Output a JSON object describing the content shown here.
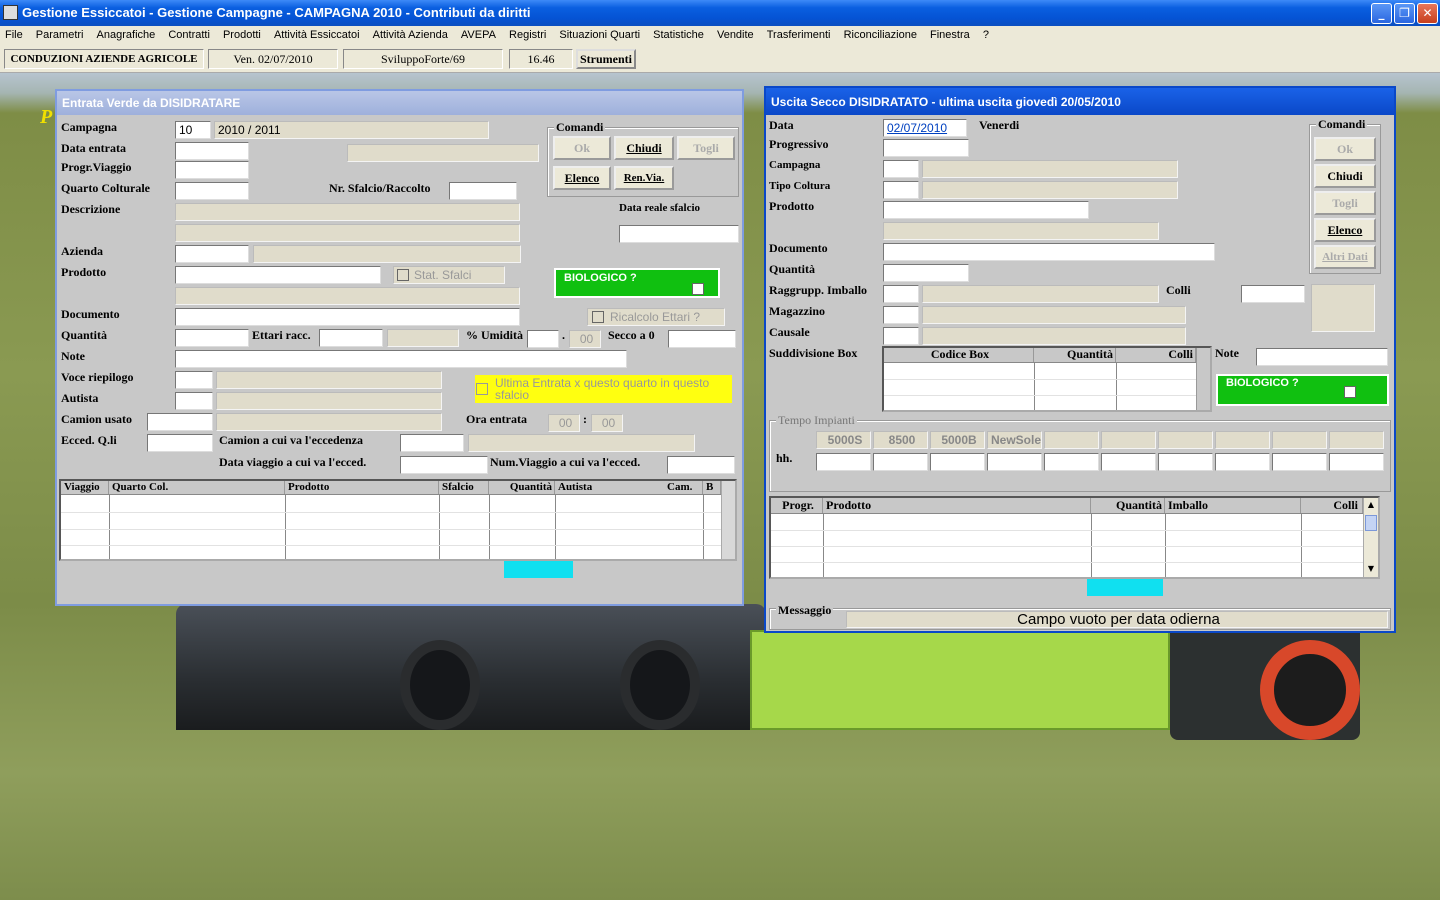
{
  "window": {
    "title": "Gestione Essiccatoi - Gestione Campagne  -  CAMPAGNA 2010 - Contributi da diritti"
  },
  "menu": [
    "File",
    "Parametri",
    "Anagrafiche",
    "Contratti",
    "Prodotti",
    "Attività Essiccatoi",
    "Attività Azienda",
    "AVEPA",
    "Registri",
    "Situazioni Quarti",
    "Statistiche",
    "Vendite",
    "Trasferimenti",
    "Riconciliazione",
    "Finestra",
    "?"
  ],
  "status": {
    "company": "CONDUZIONI AZIENDE AGRICOLE",
    "date": "Ven. 02/07/2010",
    "user": "SviluppoForte/69",
    "time": "16.46",
    "tools_label": "Strumenti"
  },
  "bg_glyph": "P",
  "entrata": {
    "title": "Entrata Verde da DISIDRATARE",
    "labels": {
      "campagna": "Campagna",
      "data_entrata": "Data entrata",
      "progr_viaggio": "Progr.Viaggio",
      "quarto": "Quarto Colturale",
      "nr_sfalcio": "Nr. Sfalcio/Raccolto",
      "descrizione": "Descrizione",
      "data_reale": "Data reale sfalcio",
      "azienda": "Azienda",
      "prodotto": "Prodotto",
      "stat_sfalci": "Stat. Sfalci",
      "biologico": "BIOLOGICO ?",
      "documento": "Documento",
      "ricalcolo": "Ricalcolo Ettari ?",
      "quantita": "Quantità",
      "ettari": "Ettari racc.",
      "umidita": "% Umidità",
      "secco": "Secco a 0",
      "note": "Note",
      "voce": "Voce riepilogo",
      "ultima": "Ultima Entrata x questo quarto in questo sfalcio",
      "autista": "Autista",
      "camion": "Camion usato",
      "ora": "Ora entrata",
      "ecced": "Ecced. Q.li",
      "camion_ecc": "Camion a cui va l'eccedenza",
      "data_viaggio": "Data viaggio a cui va l'ecced.",
      "num_viaggio": "Num.Viaggio a cui va l'ecced."
    },
    "values": {
      "campagna_code": "10",
      "campagna_year": "2010 / 2011",
      "umid_dec": "00",
      "ora_h": "00",
      "ora_m": "00",
      "sep": ":",
      "dot": "."
    },
    "commands": {
      "title": "Comandi",
      "ok": "Ok",
      "chiudi": "Chiudi",
      "togli": "Togli",
      "elenco": "Elenco",
      "renvia": "Ren.Via."
    },
    "grid_cols": [
      "Viaggio",
      "Quarto Col.",
      "Prodotto",
      "Sfalcio",
      "Quantità",
      "Autista",
      "Cam.",
      "B"
    ]
  },
  "uscita": {
    "title": "Uscita Secco DISIDRATATO - ultima uscita  giovedì 20/05/2010",
    "labels": {
      "data": "Data",
      "progressivo": "Progressivo",
      "campagna": "Campagna",
      "tipo": "Tipo Coltura",
      "prodotto": "Prodotto",
      "documento": "Documento",
      "quantita": "Quantità",
      "raggrupp": "Raggrupp. Imballo",
      "colli": "Colli",
      "magazzino": "Magazzino",
      "causale": "Causale",
      "suddivisione": "Suddivisione Box",
      "note": "Note",
      "biologico": "BIOLOGICO ?",
      "tempo": "Tempo Impianti",
      "hh": "hh.",
      "messaggio": "Messaggio"
    },
    "values": {
      "data": "02/07/2010",
      "weekday": "Venerdi"
    },
    "commands": {
      "title": "Comandi",
      "ok": "Ok",
      "chiudi": "Chiudi",
      "togli": "Togli",
      "elenco": "Elenco",
      "altri": "Altri Dati"
    },
    "box_cols": [
      "Codice Box",
      "Quantità",
      "Colli"
    ],
    "impianti": [
      "5000S",
      "8500",
      "5000B",
      "NewSole"
    ],
    "grid_cols": [
      "Progr.",
      "Prodotto",
      "Quantità",
      "Imballo",
      "Colli"
    ],
    "message": "Campo vuoto per data odierna"
  }
}
